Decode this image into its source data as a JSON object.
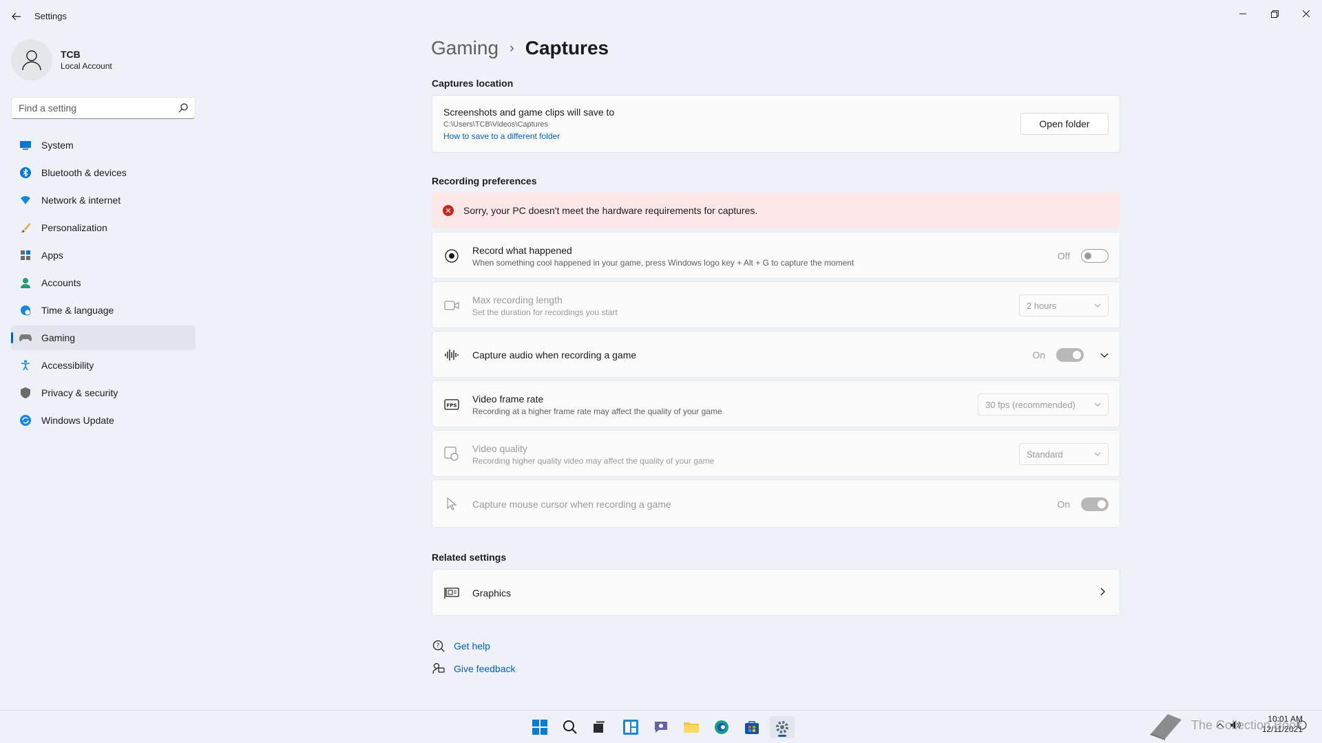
{
  "window": {
    "title": "Settings"
  },
  "profile": {
    "name": "TCB",
    "account_type": "Local Account"
  },
  "search": {
    "placeholder": "Find a setting"
  },
  "sidebar": {
    "items": [
      {
        "label": "System",
        "icon": "monitor-icon"
      },
      {
        "label": "Bluetooth & devices",
        "icon": "bluetooth-icon"
      },
      {
        "label": "Network & internet",
        "icon": "wifi-icon"
      },
      {
        "label": "Personalization",
        "icon": "brush-icon"
      },
      {
        "label": "Apps",
        "icon": "apps-icon"
      },
      {
        "label": "Accounts",
        "icon": "person-icon"
      },
      {
        "label": "Time & language",
        "icon": "globe-clock-icon"
      },
      {
        "label": "Gaming",
        "icon": "gamepad-icon",
        "selected": true
      },
      {
        "label": "Accessibility",
        "icon": "accessibility-icon"
      },
      {
        "label": "Privacy & security",
        "icon": "shield-icon"
      },
      {
        "label": "Windows Update",
        "icon": "update-icon"
      }
    ]
  },
  "breadcrumb": {
    "parent": "Gaming",
    "separator": "›",
    "current": "Captures"
  },
  "captures_location": {
    "section_title": "Captures location",
    "title": "Screenshots and game clips will save to",
    "path": "C:\\Users\\TCB\\Videos\\Captures",
    "link": "How to save to a different folder",
    "button": "Open folder"
  },
  "recording": {
    "section_title": "Recording preferences",
    "error": "Sorry, your PC doesn't meet the hardware requirements for captures.",
    "record_what_happened": {
      "title": "Record what happened",
      "desc": "When something cool happened in your game, press Windows logo key + Alt + G to capture the moment",
      "state": "Off"
    },
    "max_length": {
      "title": "Max recording length",
      "desc": "Set the duration for recordings you start",
      "value": "2 hours"
    },
    "capture_audio": {
      "title": "Capture audio when recording a game",
      "state": "On"
    },
    "frame_rate": {
      "title": "Video frame rate",
      "desc": "Recording at a higher frame rate may affect the quality of your game",
      "value": "30 fps (recommended)"
    },
    "video_quality": {
      "title": "Video quality",
      "desc": "Recording higher quality video may affect the quality of your game",
      "value": "Standard"
    },
    "mouse_cursor": {
      "title": "Capture mouse cursor when recording a game",
      "state": "On"
    }
  },
  "related": {
    "section_title": "Related settings",
    "graphics": "Graphics"
  },
  "help": {
    "get_help": "Get help",
    "give_feedback": "Give feedback"
  },
  "taskbar": {
    "time": "10:01 AM",
    "date": "12/11/2021"
  },
  "watermark": "The Collection Book",
  "colors": {
    "accent": "#005fb8",
    "error_bg": "#fde7e9",
    "error_icon": "#c42b1c"
  }
}
